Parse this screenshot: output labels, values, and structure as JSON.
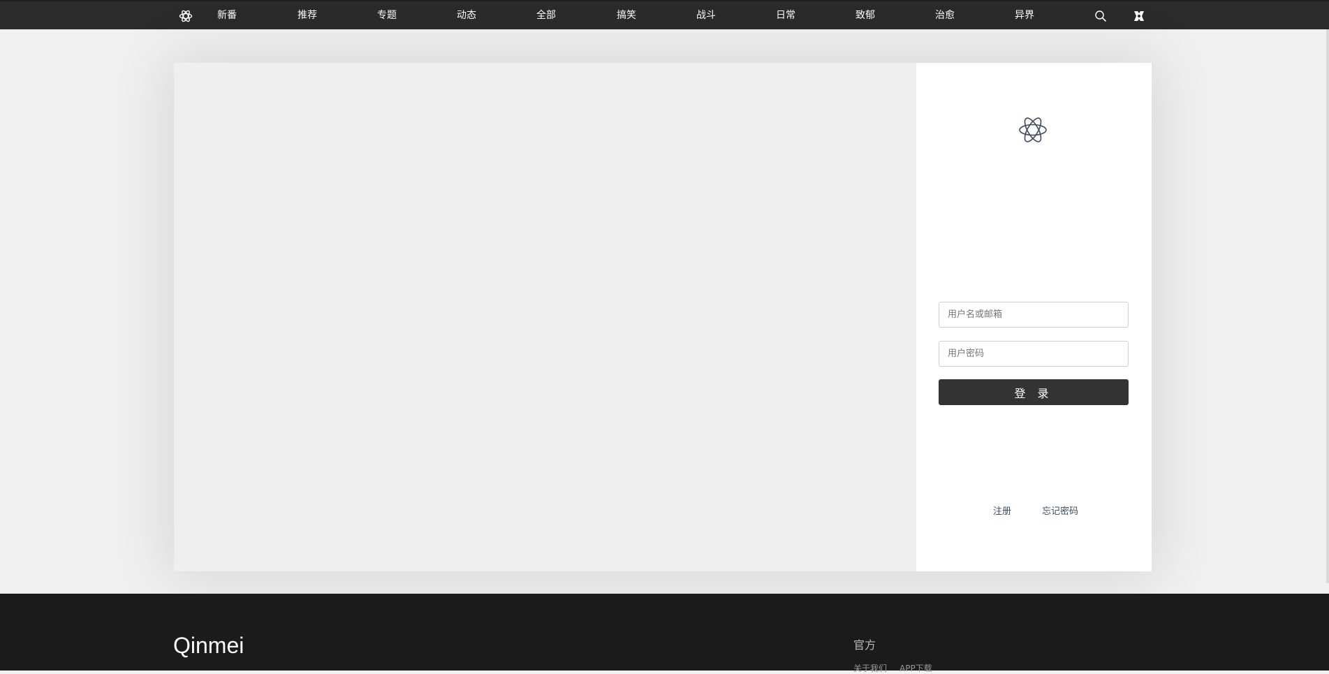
{
  "nav": {
    "items": [
      {
        "label": "新番"
      },
      {
        "label": "推荐"
      },
      {
        "label": "专题"
      },
      {
        "label": "动态"
      },
      {
        "label": "全部"
      },
      {
        "label": "搞笑"
      },
      {
        "label": "战斗"
      },
      {
        "label": "日常"
      },
      {
        "label": "致郁"
      },
      {
        "label": "治愈"
      },
      {
        "label": "异界"
      }
    ],
    "icons": {
      "logo": "atom-logo-icon",
      "search": "search-icon",
      "user": "user-icon"
    }
  },
  "login": {
    "brand_icon": "atom-logo-icon",
    "username_placeholder": "用户名或邮箱",
    "password_placeholder": "用户密码",
    "username_value": "",
    "password_value": "",
    "submit_label": "登 录",
    "register_label": "注册",
    "forgot_label": "忘记密码"
  },
  "footer": {
    "brand": "Qinmei",
    "section_heading": "官方",
    "links": [
      "关于我们",
      "APP下载"
    ]
  },
  "colors": {
    "topbar": "#2b2b2b",
    "button": "#333333",
    "footer": "#1b1b1b",
    "page_bg": "#f0f0f0"
  }
}
